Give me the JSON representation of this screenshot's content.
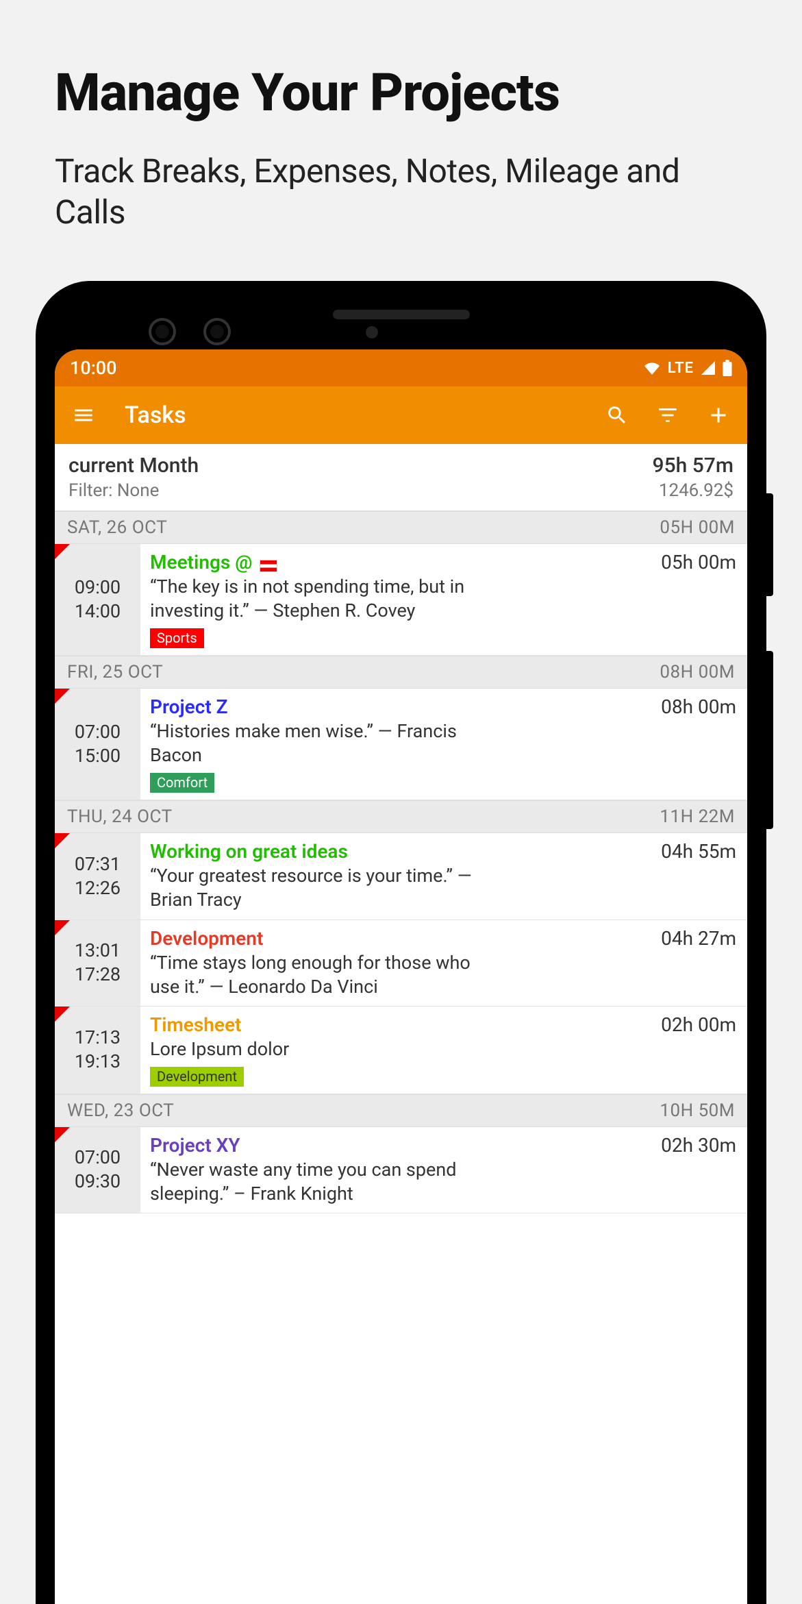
{
  "promo": {
    "title": "Manage Your Projects",
    "subtitle": "Track Breaks, Expenses, Notes, Mileage and Calls"
  },
  "status": {
    "time": "10:00",
    "network": "LTE"
  },
  "appbar": {
    "title": "Tasks"
  },
  "summary": {
    "period": "current Month",
    "filter_label": "Filter: None",
    "total_duration": "95h 57m",
    "total_amount": "1246.92$"
  },
  "colors": {
    "green": "#1fbf00",
    "blue": "#2a2aff",
    "red": "#e63a28",
    "orange": "#f09800",
    "purple": "#6a3fbc",
    "tag_red": "#ff0000",
    "tag_green": "#2f9e5a",
    "tag_lime": "#9cce00"
  },
  "days": [
    {
      "header": "SAT, 26 OCT",
      "total": "05H 00M",
      "tasks": [
        {
          "start": "09:00",
          "end": "14:00",
          "title": "Meetings @ ",
          "title_color": "green",
          "has_flag": true,
          "duration": "05h 00m",
          "note": "“The key is in not spending time, but in investing it.” ― Stephen R. Covey",
          "tag": "Sports",
          "tag_color": "tag_red"
        }
      ]
    },
    {
      "header": "FRI, 25 OCT",
      "total": "08H 00M",
      "tasks": [
        {
          "start": "07:00",
          "end": "15:00",
          "title": "Project Z",
          "title_color": "blue",
          "duration": "08h 00m",
          "note": "“Histories make men wise.” ― Francis Bacon",
          "tag": "Comfort",
          "tag_color": "tag_green"
        }
      ]
    },
    {
      "header": "THU, 24 OCT",
      "total": "11H 22M",
      "tasks": [
        {
          "start": "07:31",
          "end": "12:26",
          "title": "Working on great ideas",
          "title_color": "green",
          "duration": "04h 55m",
          "note": "“Your greatest resource is your time.” ― Brian Tracy"
        },
        {
          "start": "13:01",
          "end": "17:28",
          "title": "Development",
          "title_color": "red",
          "duration": "04h 27m",
          "note": "“Time stays long enough for those who use it.” ― Leonardo Da Vinci"
        },
        {
          "start": "17:13",
          "end": "19:13",
          "title": "Timesheet",
          "title_color": "orange",
          "duration": "02h 00m",
          "note": "Lore Ipsum dolor",
          "tag": "Development",
          "tag_color": "tag_lime"
        }
      ]
    },
    {
      "header": "WED, 23 OCT",
      "total": "10H 50M",
      "tasks": [
        {
          "start": "07:00",
          "end": "09:30",
          "title": "Project XY",
          "title_color": "purple",
          "duration": "02h 30m",
          "note": "“Never waste any time you can spend sleeping.” – Frank Knight"
        }
      ]
    }
  ]
}
